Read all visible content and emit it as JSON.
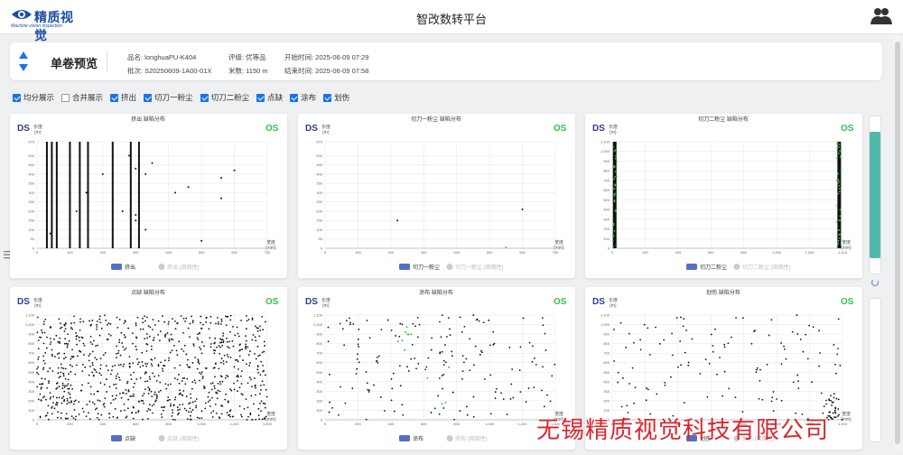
{
  "header": {
    "logo_cn": "精质视觉",
    "logo_en": "Machine vision inspection",
    "title": "智改数转平台"
  },
  "info": {
    "title": "单卷预览",
    "product_label": "品名: longhuaPU-K404",
    "batch_label": "批次: S20250609-1A00-01X",
    "grade_label": "评级: 优等品",
    "meters_label": "米数: 1150 m",
    "start_label": "开始时间: 2025-06-09 07:29",
    "end_label": "结束时间: 2025-06-09 07:58"
  },
  "filters": [
    {
      "label": "均分展示",
      "checked": true
    },
    {
      "label": "合并展示",
      "checked": false
    },
    {
      "label": "挤出",
      "checked": true
    },
    {
      "label": "切刀一粉尘",
      "checked": true
    },
    {
      "label": "切刀二粉尘",
      "checked": true
    },
    {
      "label": "点缺",
      "checked": true
    },
    {
      "label": "涂布",
      "checked": true
    },
    {
      "label": "划伤",
      "checked": true
    }
  ],
  "chart_common": {
    "ds": "DS",
    "os": "OS",
    "ylabel": "长度\n(m)",
    "xlabel": "宽度\n(mm)",
    "legend_ref": "(周期性)"
  },
  "colors": {
    "ds": "#2b3a9b",
    "os": "#38c04a",
    "legend_active": "#5470c6",
    "legend_inactive": "#cccccc",
    "defect": "#111111",
    "periodic": "#3cc43c",
    "watermark": "#d9272e",
    "scroll_thumb": "#4fb8a9"
  },
  "chart_data": [
    {
      "type": "scatter",
      "title": "挤出 缺陷分布",
      "series": [
        {
          "name": "挤出"
        },
        {
          "name": "挤出 (周期性)"
        }
      ],
      "xlim": [
        0,
        700
      ],
      "ylim": [
        0,
        575
      ],
      "xticks": [
        0,
        100,
        200,
        300,
        400,
        500,
        600,
        700
      ],
      "yticks": [
        0,
        50,
        100,
        150,
        200,
        250,
        300,
        350,
        400,
        450,
        500,
        575
      ],
      "points": [
        [
          40,
          80
        ],
        [
          420,
          300
        ],
        [
          560,
          270
        ],
        [
          300,
          150
        ],
        [
          300,
          180
        ],
        [
          330,
          100
        ],
        [
          500,
          40
        ],
        [
          460,
          330
        ],
        [
          560,
          380
        ],
        [
          350,
          460
        ],
        [
          300,
          430
        ],
        [
          330,
          400
        ],
        [
          150,
          300
        ],
        [
          200,
          400
        ],
        [
          120,
          200
        ],
        [
          260,
          200
        ],
        [
          280,
          500
        ],
        [
          600,
          420
        ]
      ],
      "lines_x": [
        30,
        45,
        60,
        100,
        130,
        155,
        230,
        285,
        310
      ]
    },
    {
      "type": "scatter",
      "title": "切刀一粉尘 缺陷分布",
      "series": [
        {
          "name": "切刀一粉尘"
        },
        {
          "name": "切刀一粉尘 (周期性)"
        }
      ],
      "xlim": [
        0,
        700
      ],
      "ylim": [
        0,
        575
      ],
      "xticks": [
        0,
        100,
        200,
        300,
        400,
        500,
        600,
        700
      ],
      "yticks": [
        0,
        50,
        100,
        150,
        200,
        250,
        300,
        350,
        400,
        450,
        500,
        575
      ],
      "points": [
        [
          220,
          150
        ],
        [
          600,
          210
        ]
      ],
      "periodic_points": [
        [
          550,
          5
        ]
      ]
    },
    {
      "type": "scatter",
      "title": "切刀二粉尘 缺陷分布",
      "series": [
        {
          "name": "切刀二粉尘"
        },
        {
          "name": "切刀二粉尘 (周期性)"
        }
      ],
      "xlim": [
        0,
        1400
      ],
      "ylim": [
        0,
        1100
      ],
      "xticks": [
        0,
        200,
        400,
        600,
        800,
        1000,
        1200,
        1418
      ],
      "yticks": [
        0,
        100,
        200,
        300,
        400,
        500,
        600,
        700,
        800,
        900,
        1000,
        1100
      ],
      "band_x": [
        15,
        1380
      ]
    },
    {
      "type": "scatter",
      "title": "点缺 缺陷分布",
      "series": [
        {
          "name": "点缺"
        },
        {
          "name": "点缺 (周期性)"
        }
      ],
      "xlim": [
        0,
        1400
      ],
      "ylim": [
        0,
        1100
      ],
      "xticks": [
        0,
        200,
        400,
        600,
        800,
        1000,
        1200,
        1400
      ],
      "yticks": [
        0,
        100,
        200,
        300,
        400,
        500,
        600,
        700,
        800,
        900,
        1000,
        1100
      ],
      "density": 900
    },
    {
      "type": "scatter",
      "title": "涂布 缺陷分布",
      "series": [
        {
          "name": "涂布"
        },
        {
          "name": "涂布 (周期性)"
        }
      ],
      "xlim": [
        0,
        1400
      ],
      "ylim": [
        0,
        1100
      ],
      "xticks": [
        0,
        200,
        400,
        600,
        800,
        1000,
        1200,
        1400
      ],
      "yticks": [
        0,
        100,
        200,
        300,
        400,
        500,
        600,
        700,
        800,
        900,
        1000,
        1100
      ],
      "density": 170,
      "periodic_count": 12
    },
    {
      "type": "scatter",
      "title": "划伤 缺陷分布",
      "series": [
        {
          "name": "划伤"
        },
        {
          "name": "划伤 (周期性)"
        }
      ],
      "xlim": [
        0,
        1400
      ],
      "ylim": [
        0,
        1100
      ],
      "xticks": [
        0,
        200,
        400,
        600,
        800,
        1000,
        1200,
        1400
      ],
      "yticks": [
        0,
        100,
        200,
        300,
        400,
        500,
        600,
        700,
        800,
        900,
        1000,
        1100
      ],
      "density": 160
    }
  ],
  "watermark": "无锡精质视觉科技有限公司"
}
